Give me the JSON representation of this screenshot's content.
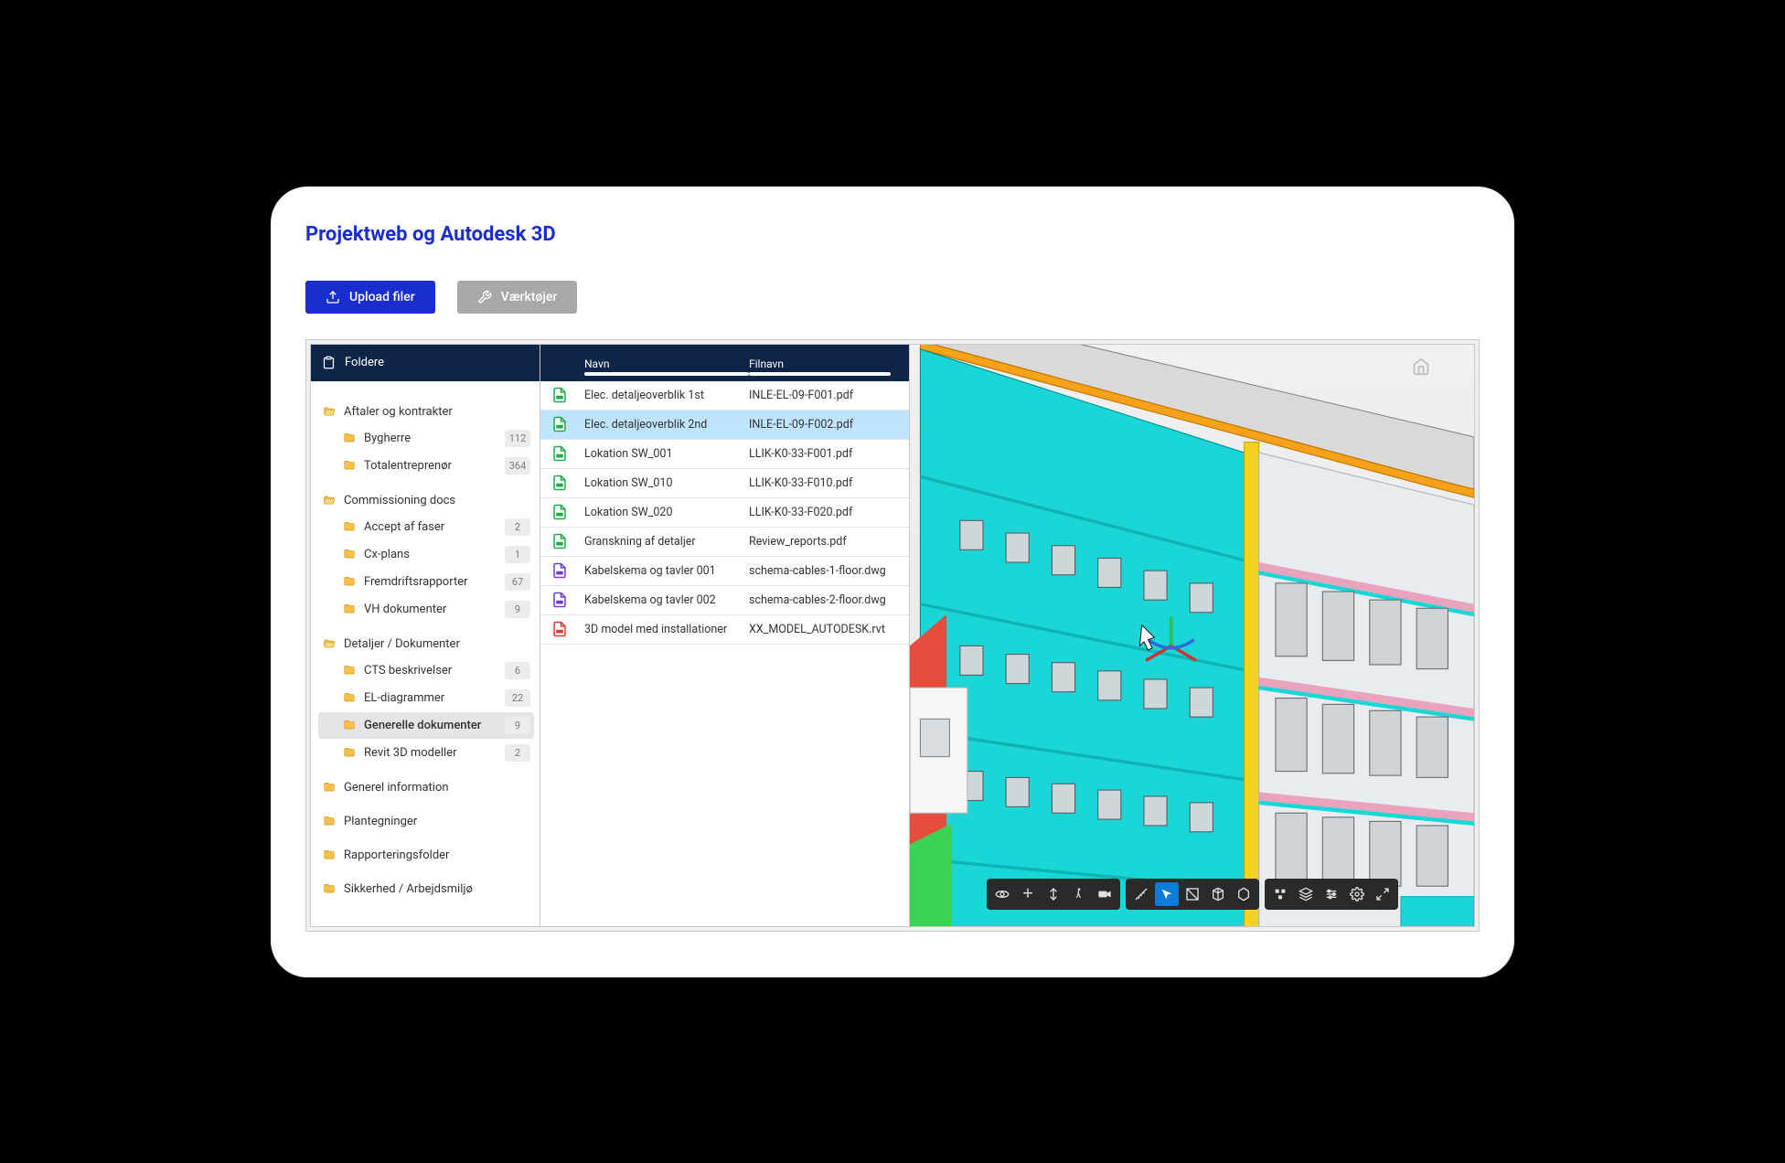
{
  "title": "Projektweb og Autodesk 3D",
  "toolbar": {
    "upload_label": "Upload filer",
    "tools_label": "Værktøjer"
  },
  "tree_header": "Foldere",
  "tree": [
    {
      "label": "Aftaler og kontrakter",
      "open": true,
      "children": [
        {
          "label": "Bygherre",
          "count": "112"
        },
        {
          "label": "Totalentreprenør",
          "count": "364"
        }
      ]
    },
    {
      "label": "Commissioning docs",
      "open": true,
      "children": [
        {
          "label": "Accept af faser",
          "count": "2"
        },
        {
          "label": "Cx-plans",
          "count": "1"
        },
        {
          "label": "Fremdriftsrapporter",
          "count": "67"
        },
        {
          "label": "VH dokumenter",
          "count": "9"
        }
      ]
    },
    {
      "label": "Detaljer / Dokumenter",
      "open": true,
      "children": [
        {
          "label": "CTS beskrivelser",
          "count": "6"
        },
        {
          "label": "EL-diagrammer",
          "count": "22"
        },
        {
          "label": "Generelle dokumenter",
          "count": "9",
          "active": true
        },
        {
          "label": "Revit 3D modeller",
          "count": "2"
        }
      ]
    },
    {
      "label": "Generel information",
      "open": false,
      "children": []
    },
    {
      "label": "Plantegninger",
      "open": false,
      "children": []
    },
    {
      "label": "Rapporteringsfolder",
      "open": false,
      "children": []
    },
    {
      "label": "Sikkerhed / Arbejdsmiljø",
      "open": false,
      "children": []
    }
  ],
  "list_headers": {
    "navn": "Navn",
    "filnavn": "Filnavn"
  },
  "files": [
    {
      "icon": "green",
      "navn": "Elec. detaljeoverblik 1st",
      "filnavn": "INLE-EL-09-F001.pdf"
    },
    {
      "icon": "green",
      "navn": "Elec. detaljeoverblik 2nd",
      "filnavn": "INLE-EL-09-F002.pdf",
      "selected": true
    },
    {
      "icon": "green",
      "navn": "Lokation SW_001",
      "filnavn": "LLIK-K0-33-F001.pdf"
    },
    {
      "icon": "green",
      "navn": "Lokation SW_010",
      "filnavn": "LLIK-K0-33-F010.pdf"
    },
    {
      "icon": "green",
      "navn": "Lokation SW_020",
      "filnavn": "LLIK-K0-33-F020.pdf"
    },
    {
      "icon": "green",
      "navn": "Granskning af detaljer",
      "filnavn": "Review_reports.pdf"
    },
    {
      "icon": "purple",
      "navn": "Kabelskema og tavler 001",
      "filnavn": "schema-cables-1-floor.dwg"
    },
    {
      "icon": "purple",
      "navn": "Kabelskema og tavler 002",
      "filnavn": "schema-cables-2-floor.dwg"
    },
    {
      "icon": "red",
      "navn": "3D model med installationer",
      "filnavn": "XX_MODEL_AUTODESK.rvt"
    }
  ],
  "viewer_tools": {
    "left": [
      "orbit",
      "pan",
      "zoom",
      "walk",
      "camera"
    ],
    "mid": [
      "measure",
      "select",
      "section",
      "model-browser",
      "properties"
    ],
    "right": [
      "explode",
      "layers",
      "settings-list",
      "settings-gear",
      "fullscreen"
    ],
    "active": "select"
  }
}
